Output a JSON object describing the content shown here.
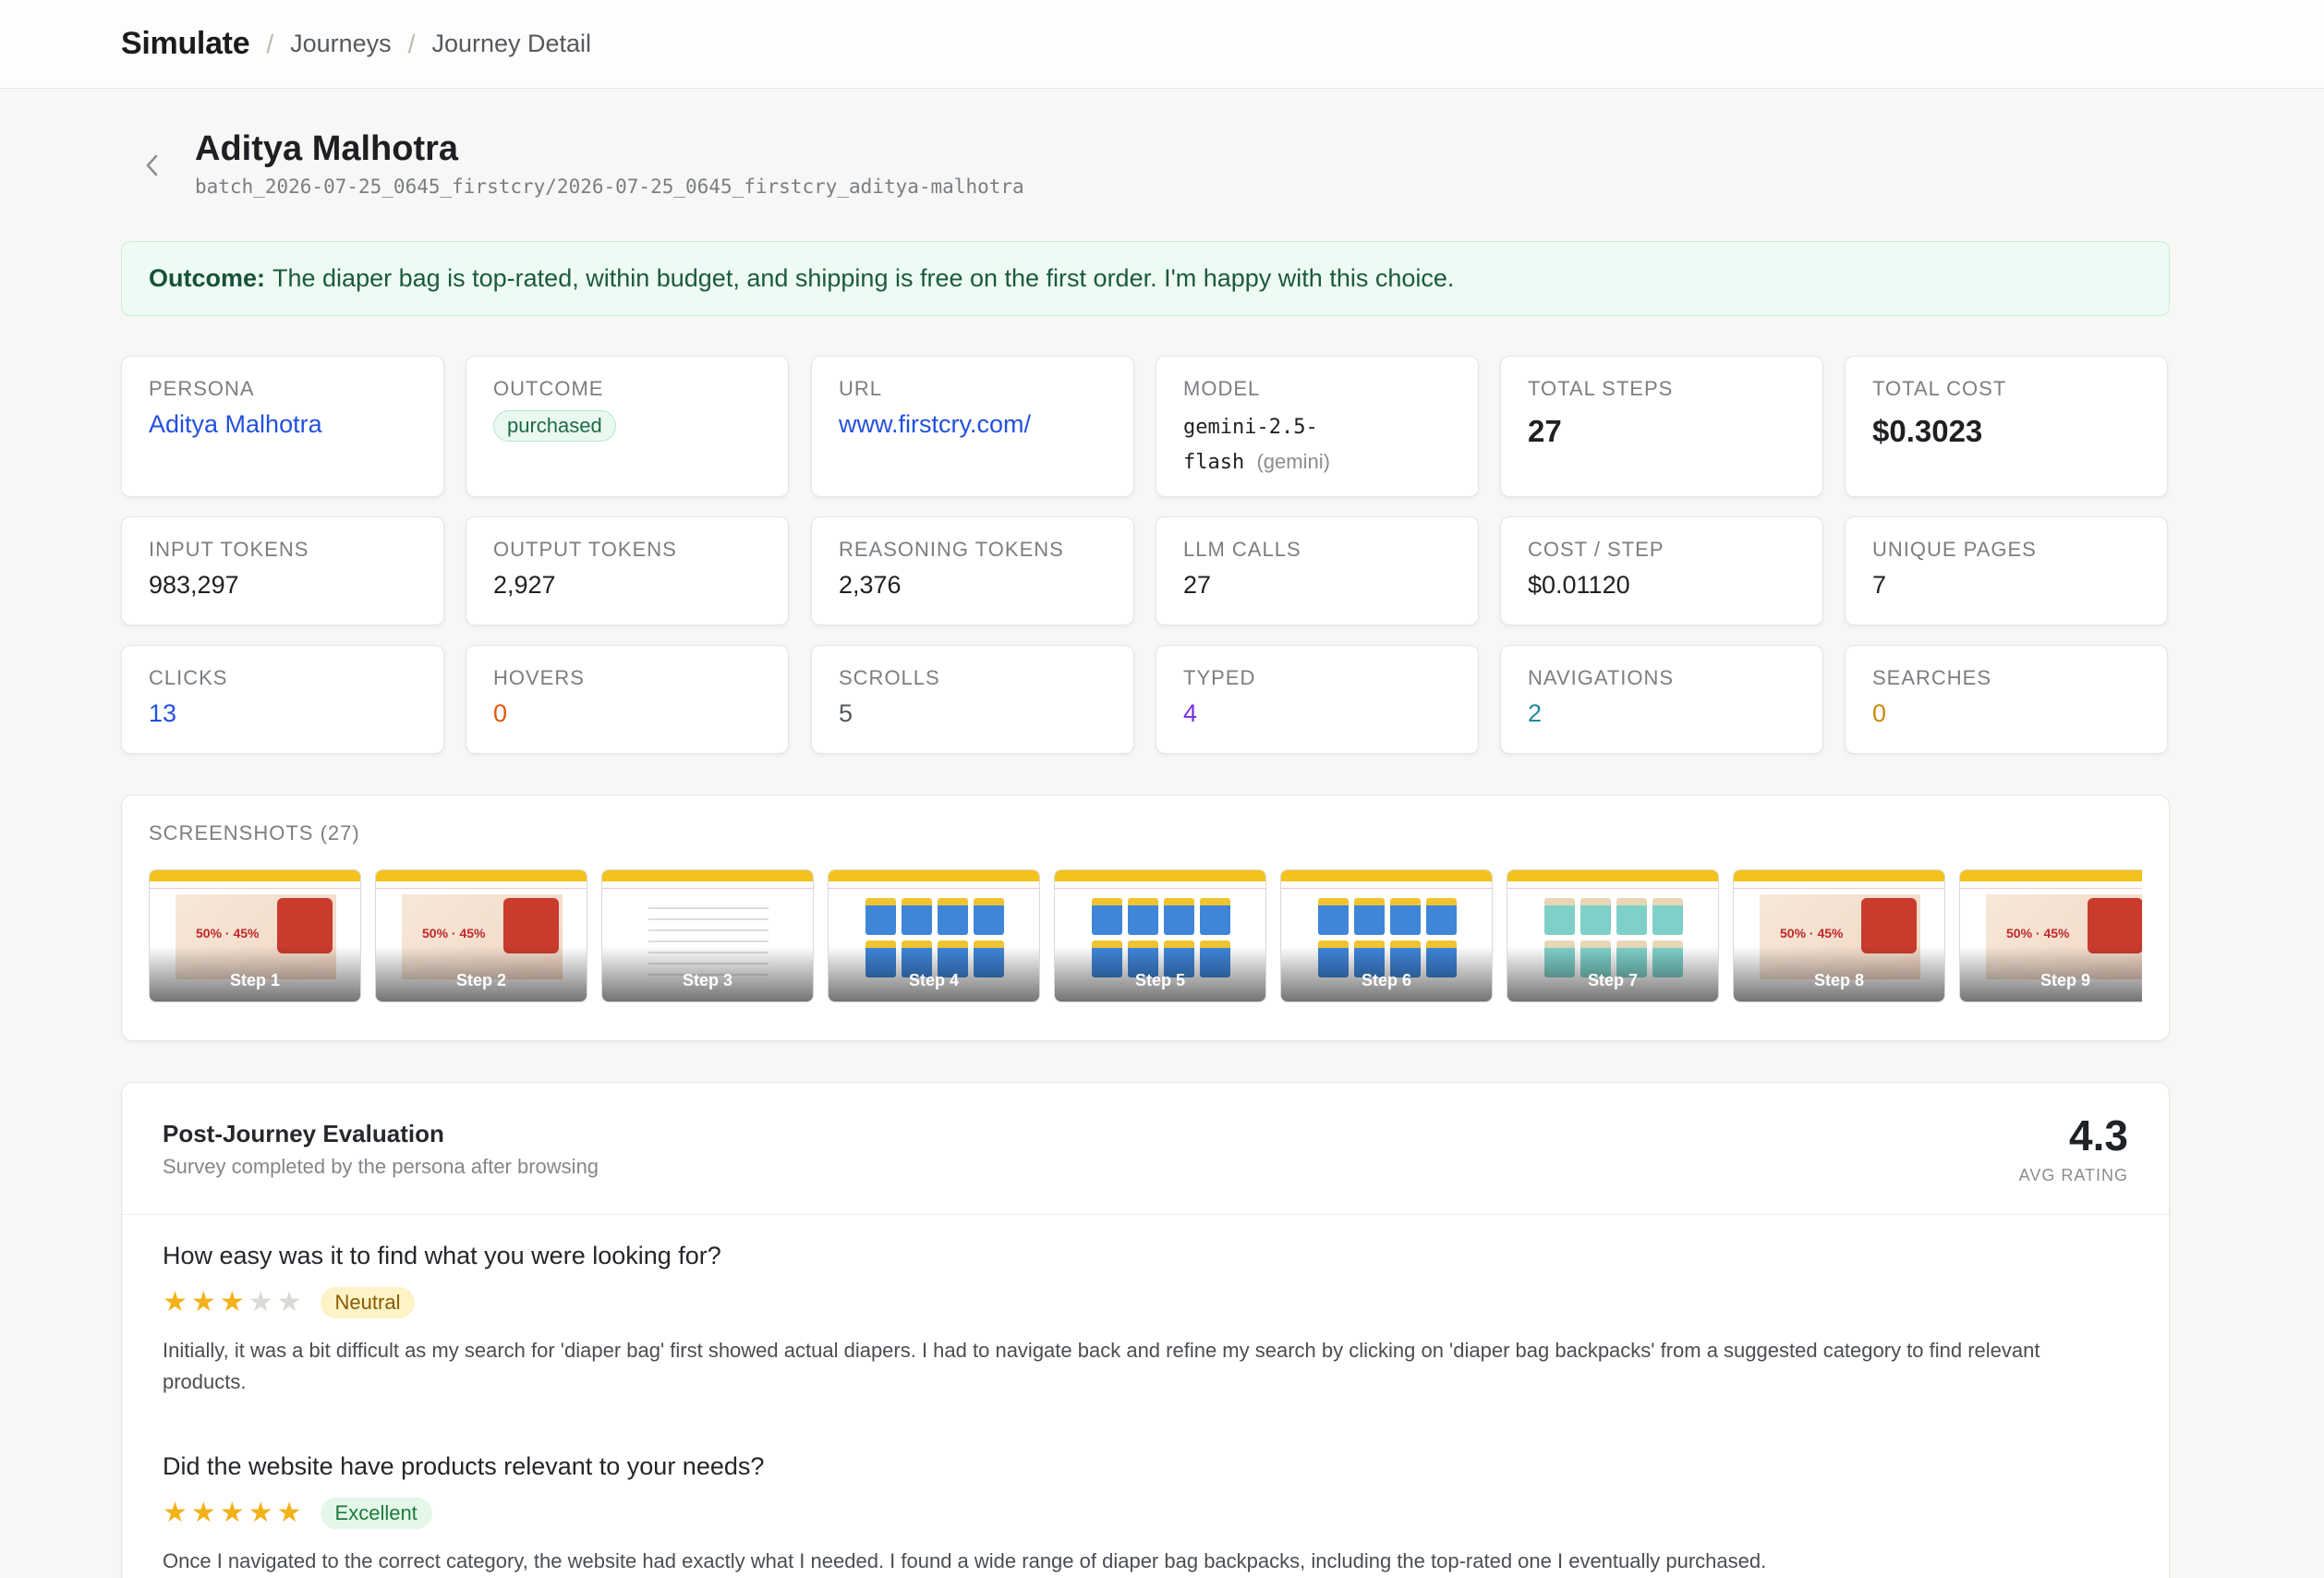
{
  "topbar": {
    "brand": "Simulate",
    "breadcrumb": [
      "Journeys",
      "Journey Detail"
    ]
  },
  "journey": {
    "title": "Aditya Malhotra",
    "path": "batch_2026-07-25_0645_firstcry/2026-07-25_0645_firstcry_aditya-malhotra"
  },
  "outcome_banner": {
    "label": "Outcome:",
    "text": "The diaper bag is top-rated, within budget, and shipping is free on the first order. I'm happy with this choice."
  },
  "stats": {
    "persona": {
      "label": "PERSONA",
      "value": "Aditya Malhotra"
    },
    "outcome": {
      "label": "OUTCOME",
      "value": "purchased"
    },
    "url": {
      "label": "URL",
      "value": "www.firstcry.com/"
    },
    "model": {
      "label": "MODEL",
      "line1": "gemini-2.5-",
      "line2": "flash",
      "provider": "(gemini)"
    },
    "total_steps": {
      "label": "TOTAL STEPS",
      "value": "27"
    },
    "total_cost": {
      "label": "TOTAL COST",
      "value": "$0.3023"
    },
    "input_tokens": {
      "label": "INPUT TOKENS",
      "value": "983,297"
    },
    "output_tokens": {
      "label": "OUTPUT TOKENS",
      "value": "2,927"
    },
    "reasoning_tokens": {
      "label": "REASONING TOKENS",
      "value": "2,376"
    },
    "llm_calls": {
      "label": "LLM CALLS",
      "value": "27"
    },
    "cost_per_step": {
      "label": "COST / STEP",
      "value": "$0.01120"
    },
    "unique_pages": {
      "label": "UNIQUE PAGES",
      "value": "7"
    },
    "clicks": {
      "label": "CLICKS",
      "value": "13"
    },
    "hovers": {
      "label": "HOVERS",
      "value": "0"
    },
    "scrolls": {
      "label": "SCROLLS",
      "value": "5"
    },
    "typed": {
      "label": "TYPED",
      "value": "4"
    },
    "navigations": {
      "label": "NAVIGATIONS",
      "value": "2"
    },
    "searches": {
      "label": "SEARCHES",
      "value": "0"
    }
  },
  "colors": {
    "clicks": "#2350e0",
    "hovers": "#e0570f",
    "scrolls": "#55595e",
    "typed": "#7a2fe0",
    "navigations": "#1f8a9e",
    "searches": "#c98a0a"
  },
  "screenshots": {
    "title": "SCREENSHOTS (27)",
    "items": [
      {
        "label": "Step 1",
        "kind": "banner"
      },
      {
        "label": "Step 2",
        "kind": "banner-products"
      },
      {
        "label": "Step 3",
        "kind": "list"
      },
      {
        "label": "Step 4",
        "kind": "grid"
      },
      {
        "label": "Step 5",
        "kind": "grid"
      },
      {
        "label": "Step 6",
        "kind": "grid"
      },
      {
        "label": "Step 7",
        "kind": "grid-teal"
      },
      {
        "label": "Step 8",
        "kind": "banner"
      },
      {
        "label": "Step 9",
        "kind": "banner"
      }
    ]
  },
  "evaluation": {
    "title": "Post-Journey Evaluation",
    "subtitle": "Survey completed by the persona after browsing",
    "avg_rating": "4.3",
    "avg_label": "AVG RATING",
    "questions": [
      {
        "question": "How easy was it to find what you were looking for?",
        "stars": 3,
        "tag": "Neutral",
        "answer": "Initially, it was a bit difficult as my search for 'diaper bag' first showed actual diapers. I had to navigate back and refine my search by clicking on 'diaper bag backpacks' from a suggested category to find relevant products."
      },
      {
        "question": "Did the website have products relevant to your needs?",
        "stars": 5,
        "tag": "Excellent",
        "answer": "Once I navigated to the correct category, the website had exactly what I needed. I found a wide range of diaper bag backpacks, including the top-rated one I eventually purchased."
      }
    ]
  }
}
